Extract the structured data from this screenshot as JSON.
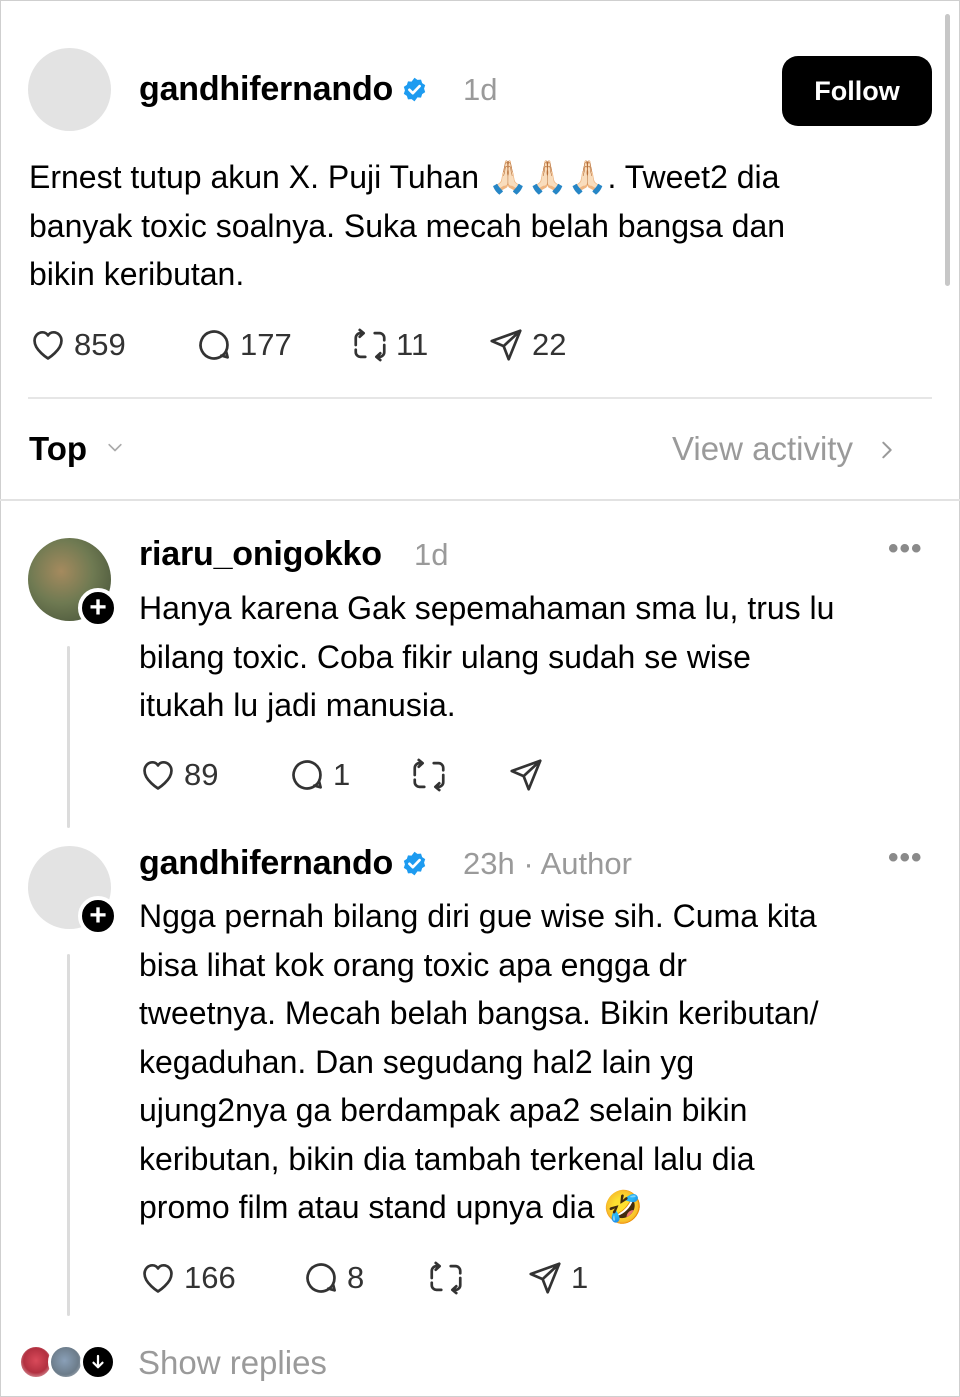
{
  "post": {
    "username": "gandhifernando",
    "time": "1d",
    "follow_label": "Follow",
    "text": "Ernest tutup akun X. Puji Tuhan 🙏🏻🙏🏻🙏🏻. Tweet2 dia\nbanyak toxic soalnya. Suka mecah belah bangsa dan\nbikin keributan.",
    "likes": "859",
    "comments": "177",
    "reposts": "11",
    "shares": "22"
  },
  "sort": {
    "label": "Top",
    "view_activity": "View activity"
  },
  "replies": [
    {
      "username": "riaru_onigokko",
      "time": "1d",
      "text": "Hanya karena Gak sepemahaman sma lu, trus lu\nbilang toxic. Coba fikir ulang sudah se wise\nitukah lu jadi manusia.",
      "likes": "89",
      "comments": "1"
    },
    {
      "username": "gandhifernando",
      "time": "23h",
      "author_tag": "· Author",
      "text": "Ngga pernah bilang diri gue wise sih. Cuma kita\nbisa lihat kok orang toxic apa engga dr\ntweetnya. Mecah belah bangsa. Bikin keributan/\nkegaduhan. Dan segudang hal2 lain yg\nujung2nya ga berdampak apa2 selain bikin\nkeributan, bikin dia tambah terkenal lalu dia\npromo film atau stand upnya dia 🤣",
      "likes": "166",
      "comments": "8",
      "shares": "1"
    }
  ],
  "show_replies": "Show replies",
  "colors": {
    "verified": "#1d9bf0",
    "text": "#000000",
    "muted": "#9a9a9a"
  }
}
